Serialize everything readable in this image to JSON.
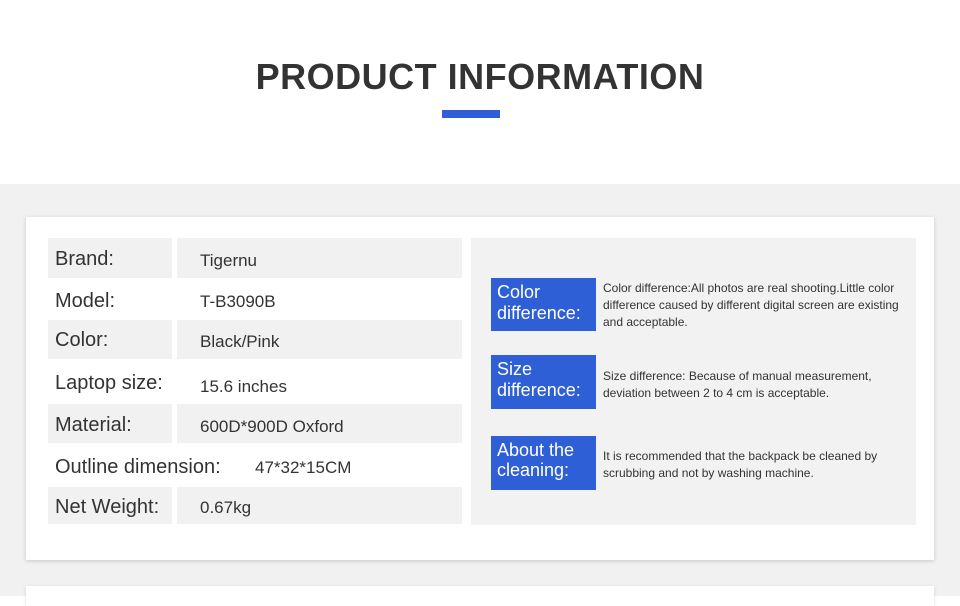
{
  "header": {
    "title": "PRODUCT INFORMATION",
    "accent_color": "#2f5fd6"
  },
  "specs": [
    {
      "label": "Brand:",
      "value": "Tigernu"
    },
    {
      "label": "Model:",
      "value": "T-B3090B"
    },
    {
      "label": "Color:",
      "value": "Black/Pink"
    },
    {
      "label": "Laptop size:",
      "value": "15.6 inches"
    },
    {
      "label": "Material:",
      "value": "600D*900D Oxford"
    },
    {
      "label": "Outline dimension:",
      "value": "47*32*15CM"
    },
    {
      "label": "Net Weight:",
      "value": "0.67kg"
    }
  ],
  "notes": [
    {
      "label": "Color difference:",
      "text": "Color difference:All photos are real shooting.Little color difference caused by different digital screen are existing and acceptable."
    },
    {
      "label": "Size difference:",
      "text": "Size difference: Because of manual measurement, deviation between 2 to 4 cm is acceptable."
    },
    {
      "label": "About the cleaning:",
      "text": "It is recommended that the backpack be cleaned by scrubbing and not by washing machine."
    }
  ]
}
